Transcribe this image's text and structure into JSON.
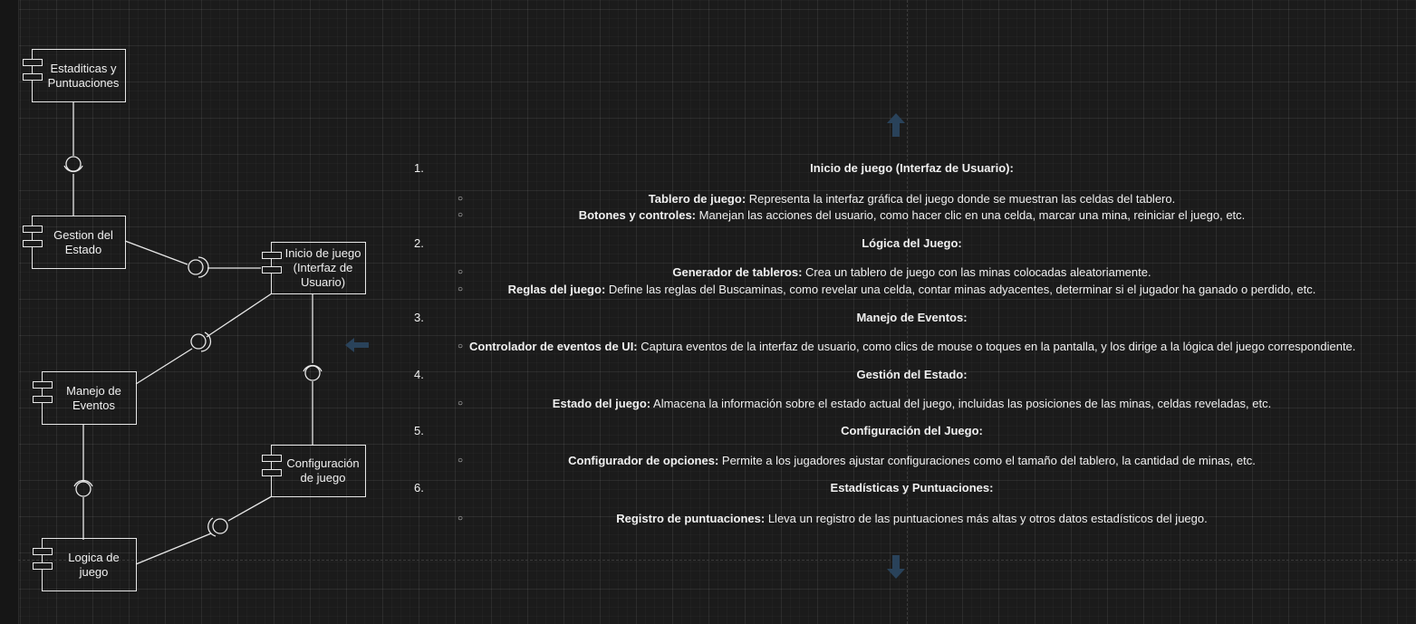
{
  "components": {
    "estadisticas": "Estaditicas y\nPuntuaciones",
    "gestion": "Gestion del\nEstado",
    "inicio": "Inicio de juego\n(Interfaz de\nUsuario)",
    "manejo": "Manejo de\nEventos",
    "configuracion": "Configuración\nde juego",
    "logica": "Logica de\njuego"
  },
  "list": {
    "items": [
      {
        "num": "1.",
        "title": "Inicio de juego (Interfaz de Usuario):",
        "subs": [
          {
            "bold": "Tablero de juego:",
            "text": " Representa la interfaz gráfica del juego donde se muestran las celdas del tablero."
          },
          {
            "bold": "Botones y controles:",
            "text": " Manejan las acciones del usuario, como hacer clic en una celda, marcar una mina, reiniciar el juego, etc."
          }
        ]
      },
      {
        "num": "2.",
        "title": "Lógica del Juego:",
        "subs": [
          {
            "bold": "Generador de tableros:",
            "text": " Crea un tablero de juego con las minas colocadas aleatoriamente."
          },
          {
            "bold": "Reglas del juego:",
            "text": " Define las reglas del Buscaminas, como revelar una celda, contar minas adyacentes, determinar si el jugador ha ganado o perdido, etc."
          }
        ]
      },
      {
        "num": "3.",
        "title": "Manejo de Eventos:",
        "subs": [
          {
            "bold": "Controlador de eventos de UI:",
            "text": " Captura eventos de la interfaz de usuario, como clics de mouse o toques en la pantalla, y los dirige a la lógica del juego correspondiente."
          }
        ]
      },
      {
        "num": "4.",
        "title": "Gestión del Estado:",
        "subs": [
          {
            "bold": "Estado del juego:",
            "text": " Almacena la información sobre el estado actual del juego, incluidas las posiciones de las minas, celdas reveladas, etc."
          }
        ]
      },
      {
        "num": "5.",
        "title": "Configuración del Juego:",
        "subs": [
          {
            "bold": "Configurador de opciones:",
            "text": " Permite a los jugadores ajustar configuraciones como el tamaño del tablero, la cantidad de minas, etc."
          }
        ]
      },
      {
        "num": "6.",
        "title": "Estadísticas y Puntuaciones:",
        "subs": [
          {
            "bold": "Registro de puntuaciones:",
            "text": " Lleva un registro de las puntuaciones más altas y otros datos estadísticos del juego."
          }
        ]
      }
    ]
  },
  "icons": {
    "arrow_up": "arrow-up-icon",
    "arrow_left": "arrow-left-icon",
    "arrow_down": "arrow-down-icon"
  },
  "colors": {
    "background": "#1b1b1b",
    "stroke": "#e8e8e8",
    "text": "#f0f0f0",
    "nav_arrow": "#29425a"
  }
}
